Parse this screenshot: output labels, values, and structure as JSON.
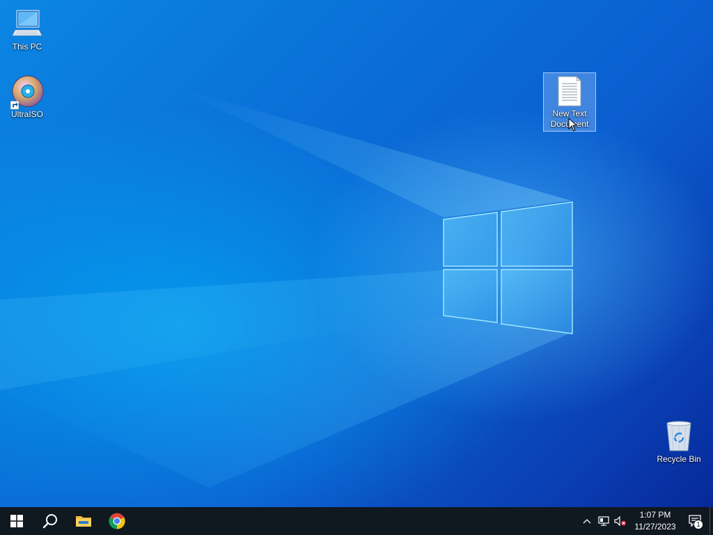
{
  "desktop": {
    "icons": [
      {
        "label": "This PC",
        "icon": "computer-icon"
      },
      {
        "label": "UltraISO",
        "icon": "disc-icon",
        "shortcut": true
      },
      {
        "label": "New Text Document",
        "icon": "text-file-icon",
        "selected": true
      },
      {
        "label": "Recycle Bin",
        "icon": "recycle-bin-icon"
      }
    ]
  },
  "taskbar": {
    "start_icon": "windows-logo-icon",
    "search_icon": "search-icon",
    "pinned": [
      {
        "name": "File Explorer",
        "icon": "folder-icon"
      },
      {
        "name": "Google Chrome",
        "icon": "chrome-icon"
      }
    ],
    "tray": {
      "chevron_icon": "chevron-up-icon",
      "network_icon": "network-icon",
      "volume_icon": "volume-muted-icon",
      "time": "1:07 PM",
      "date": "11/27/2023",
      "notification_count": "1"
    }
  },
  "colors": {
    "taskbar_bg": "#101820",
    "wallpaper_accent": "#0a6fd8"
  }
}
